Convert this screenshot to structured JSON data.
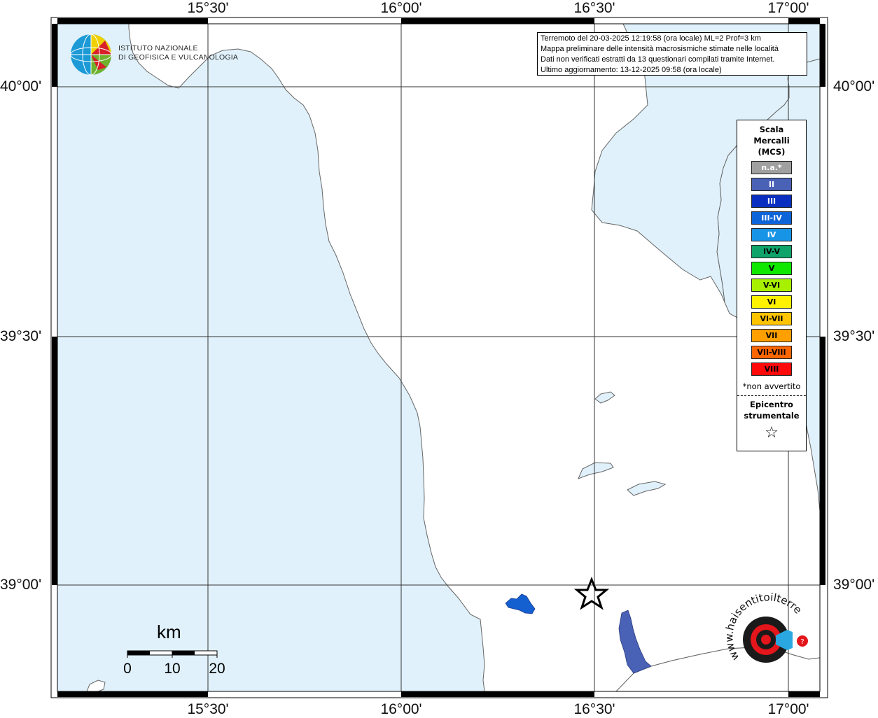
{
  "map": {
    "longitude_labels": [
      "15°30'",
      "16°00'",
      "16°30'",
      "17°00'"
    ],
    "latitude_labels": [
      "40°00'",
      "39°30'",
      "39°00'"
    ],
    "sea_color": "#e0f1fb",
    "land_color": "#ffffff"
  },
  "logo": {
    "line1": "ISTITUTO NAZIONALE",
    "line2": "DI GEOFISICA E VULCANOLOGIA"
  },
  "info_box": {
    "line1": "Terremoto del 20-03-2025 12:19:58 (ora locale) ML=2 Prof=3 km",
    "line2": "Mappa preliminare delle intensità macrosismiche stimate nelle località",
    "line3": "Dati non verificati estratti da 13 questionari compilati tramite Internet.",
    "line4": "Ultimo aggiornamento: 13-12-2025 09:58 (ora locale)"
  },
  "legend": {
    "title_line1": "Scala",
    "title_line2": "Mercalli",
    "title_line3": "(MCS)",
    "items": [
      {
        "label": "n.a.*",
        "color": "#a0a0a0"
      },
      {
        "label": "II",
        "color": "#4a62b5"
      },
      {
        "label": "III",
        "color": "#0a2fc0"
      },
      {
        "label": "III-IV",
        "color": "#0d63d8"
      },
      {
        "label": "IV",
        "color": "#1794e6"
      },
      {
        "label": "IV-V",
        "color": "#10a46a"
      },
      {
        "label": "V",
        "color": "#10e800"
      },
      {
        "label": "V-VI",
        "color": "#a6f000"
      },
      {
        "label": "VI",
        "color": "#fff200"
      },
      {
        "label": "VI-VII",
        "color": "#ffc400"
      },
      {
        "label": "VII",
        "color": "#ff9f00"
      },
      {
        "label": "VII-VIII",
        "color": "#ff6600"
      },
      {
        "label": "VIII",
        "color": "#ff0a0a"
      }
    ],
    "na_note": "*non avvertito",
    "epicenter_line1": "Epicentro",
    "epicenter_line2": "strumentale",
    "epicenter_symbol": "☆"
  },
  "scale_bar": {
    "unit": "km",
    "ticks": [
      "0",
      "10",
      "20"
    ]
  },
  "watermark": {
    "text": "www.haisentitoilterremoto.it",
    "colors": [
      "#000000",
      "#e4161b",
      "#2aa7e0"
    ]
  }
}
